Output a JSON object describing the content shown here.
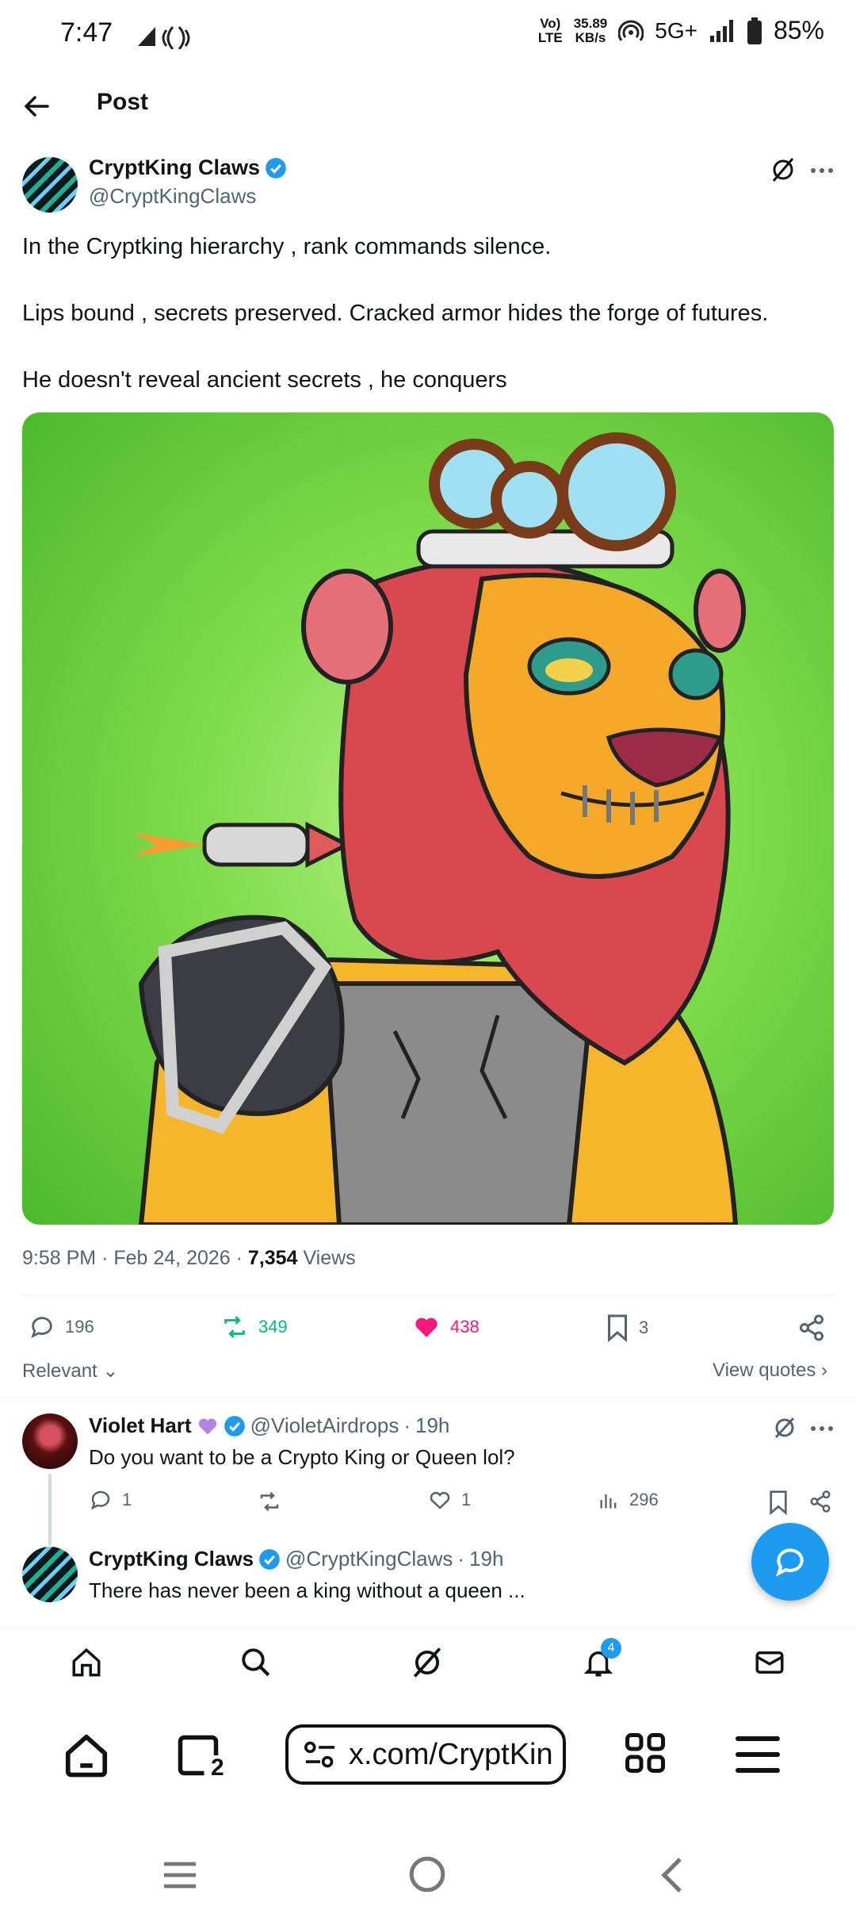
{
  "status_bar": {
    "time": "7:47",
    "net_top": "35.89",
    "net_bottom": "KB/s",
    "volte_top": "Vo)",
    "volte_bottom": "LTE",
    "network": "5G+",
    "battery": "85%"
  },
  "header": {
    "title": "Post"
  },
  "post": {
    "author_name": "CryptKing Claws",
    "author_handle": "@CryptKingClaws",
    "paragraphs": [
      "In the Cryptking hierarchy , rank commands silence.",
      "Lips bound , secrets preserved. Cracked armor hides the forge of futures.",
      "He doesn't reveal ancient secrets , he conquers"
    ],
    "time": "9:58 PM",
    "date": "Feb 24, 2026",
    "views_count": "7,354",
    "views_label": "Views",
    "replies": "196",
    "reposts": "349",
    "likes": "438",
    "bookmarks": "3"
  },
  "sort": {
    "label": "Relevant",
    "view_quotes": "View quotes"
  },
  "replies": [
    {
      "name": "Violet Hart",
      "handle": "@VioletAirdrops",
      "age": "19h",
      "text": "Do you want to be a Crypto King or Queen lol?",
      "replies": "1",
      "likes": "1",
      "views": "296"
    },
    {
      "name": "CryptKing Claws",
      "handle": "@CryptKingClaws",
      "age": "19h",
      "text": "There has never been a king without a queen ..."
    }
  ],
  "tabs": {
    "notifications_badge": "4"
  },
  "browser": {
    "url": "x.com/CryptKin",
    "tab_count": "2"
  },
  "colors": {
    "accent": "#1d9bf0",
    "like": "#f91880",
    "repost": "#00ba7c"
  }
}
